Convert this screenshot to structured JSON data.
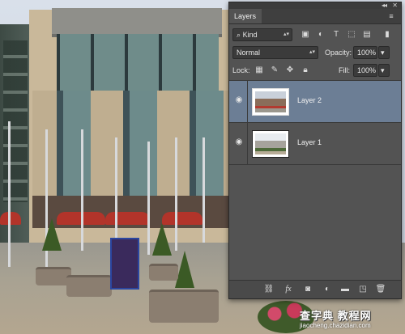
{
  "panel": {
    "tab_label": "Layers",
    "collapse_glyph": "◂◂",
    "close_glyph": "✕",
    "menu_glyph": "≡",
    "filter": {
      "kind_label": "Kind",
      "search_glyph": "⌕"
    },
    "blend": {
      "mode": "Normal",
      "opacity_label": "Opacity:",
      "opacity_value": "100%"
    },
    "lock": {
      "lock_label": "Lock:",
      "fill_label": "Fill:",
      "fill_value": "100%"
    },
    "layers": [
      {
        "name": "Layer 2",
        "selected": true,
        "visible": true
      },
      {
        "name": "Layer 1",
        "selected": false,
        "visible": true
      }
    ],
    "footer_icons": [
      "link-layers-icon",
      "fx-icon",
      "add-mask-icon",
      "adjustment-layer-icon",
      "new-group-icon",
      "new-layer-icon",
      "trash-icon"
    ],
    "selection_color": "#6c7e95",
    "panel_color": "#535353"
  },
  "watermark": {
    "line1": "查字典 教程网",
    "line2": "jiaocheng.chazidian.com"
  }
}
